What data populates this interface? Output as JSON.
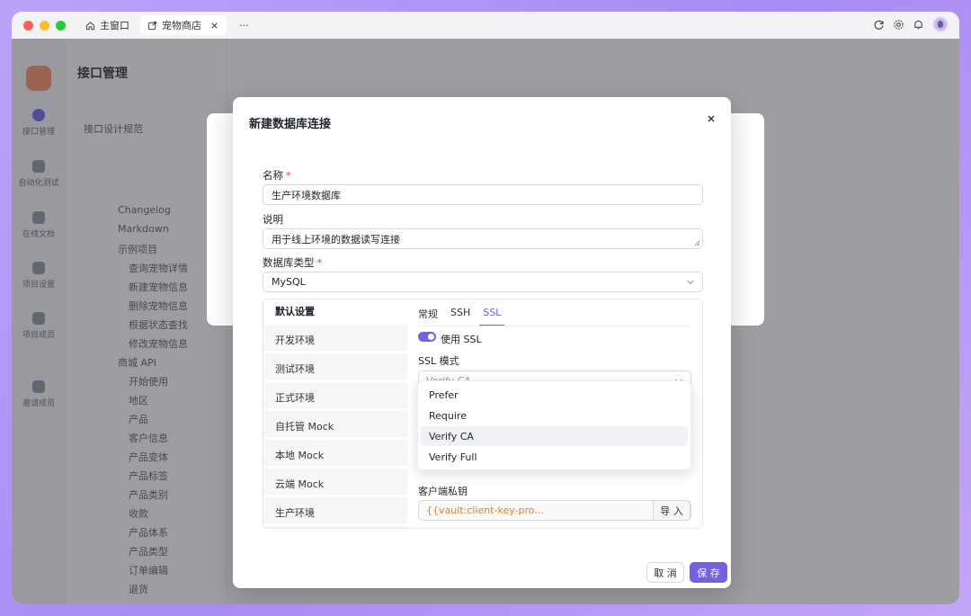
{
  "titlebar": {
    "tabs": [
      {
        "label": "主窗口",
        "icon": "home-icon"
      },
      {
        "label": "宠物商店",
        "icon": "link-icon"
      }
    ],
    "more": "···"
  },
  "background": {
    "title": "接口管理",
    "rail": [
      "接口管理",
      "自动化测试",
      "在线文档",
      "项目设置",
      "项目成员",
      "邀请成员"
    ],
    "tree": [
      "接口设计规范",
      "Changelog",
      "Markdown",
      "示例项目",
      "查询宠物详情",
      "新建宠物信息",
      "删除宠物信息",
      "根据状态查找",
      "修改宠物信息",
      "商城 API",
      "开始使用",
      "地区",
      "产品",
      "客户信息",
      "产品变体",
      "产品标签",
      "产品类别",
      "收款",
      "产品体系",
      "产品类型",
      "订单编辑",
      "退货"
    ]
  },
  "modal": {
    "title": "新建数据库连接",
    "name_label": "名称",
    "name_value": "生产环境数据库",
    "desc_label": "说明",
    "desc_value": "用于线上环境的数据读写连接",
    "type_label": "数据库类型",
    "type_value": "MySQL",
    "required_mark": "*",
    "env_header": "默认设置",
    "envs": [
      "开发环境",
      "测试环境",
      "正式环境",
      "自托管 Mock",
      "本地 Mock",
      "云端 Mock",
      "生产环境"
    ],
    "sub_tabs": [
      "常规",
      "SSH",
      "SSL"
    ],
    "use_ssl_label": "使用 SSL",
    "ssl_mode_label": "SSL 模式",
    "ssl_mode_value": "Verify CA",
    "ssl_options": [
      "Prefer",
      "Require",
      "Verify CA",
      "Verify Full"
    ],
    "client_key_label": "客户端私钥",
    "client_key_value": "{{vault:client-key-pro...",
    "import_label": "导 入",
    "cancel_label": "取 消",
    "save_label": "保 存"
  },
  "colors": {
    "accent": "#7560e0",
    "required": "#f5464d",
    "vault_text": "#d9822b"
  }
}
